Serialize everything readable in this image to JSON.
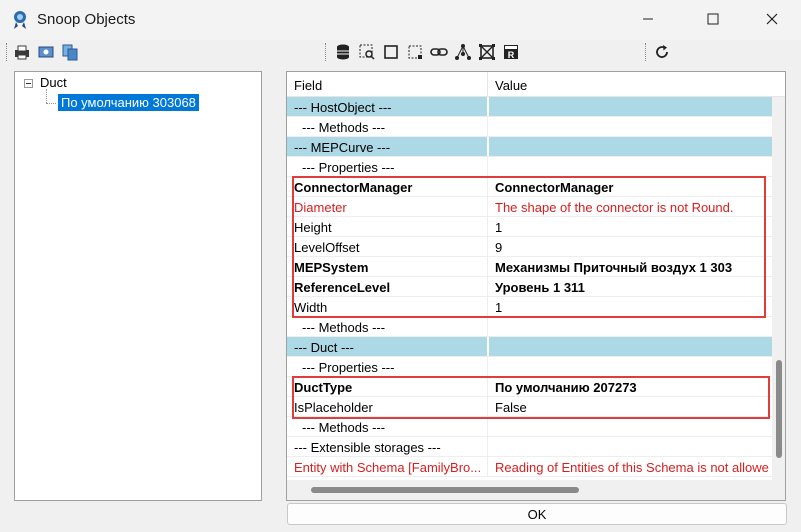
{
  "window": {
    "title": "Snoop Objects",
    "icon": "revit-lookup-icon"
  },
  "toolbar": {
    "left_icons": [
      "print-icon",
      "print-preview-icon",
      "copy-icon"
    ],
    "middle_icons": [
      "snoop-db-icon",
      "snoop-selection-icon",
      "snoop-element-icon",
      "snoop-pick-face-icon",
      "snoop-link-icon",
      "snoop-dependents-icon",
      "snoop-view-icon",
      "snoop-revit-app-icon"
    ],
    "right_icons": [
      "refresh-icon"
    ]
  },
  "tree": {
    "root": "Duct",
    "child": "По умолчанию  303068"
  },
  "grid": {
    "headers": {
      "field": "Field",
      "value": "Value"
    },
    "rows": [
      {
        "type": "section",
        "field": "--- HostObject ---",
        "value": ""
      },
      {
        "type": "sub",
        "field": "--- Methods ---",
        "value": ""
      },
      {
        "type": "section",
        "field": "--- MEPCurve ---",
        "value": ""
      },
      {
        "type": "sub",
        "field": "--- Properties ---",
        "value": ""
      },
      {
        "type": "bold",
        "field": "ConnectorManager",
        "value": "ConnectorManager"
      },
      {
        "type": "red",
        "field": "Diameter",
        "value": "The shape of the connector is not Round."
      },
      {
        "type": "plain",
        "field": "Height",
        "value": "1"
      },
      {
        "type": "plain",
        "field": "LevelOffset",
        "value": "9"
      },
      {
        "type": "bold",
        "field": "MEPSystem",
        "value": "Механизмы Приточный воздух 1  303"
      },
      {
        "type": "bold",
        "field": "ReferenceLevel",
        "value": "Уровень 1  311"
      },
      {
        "type": "plain",
        "field": "Width",
        "value": "1"
      },
      {
        "type": "sub",
        "field": "--- Methods ---",
        "value": ""
      },
      {
        "type": "section",
        "field": "--- Duct ---",
        "value": ""
      },
      {
        "type": "sub",
        "field": "--- Properties ---",
        "value": ""
      },
      {
        "type": "bold",
        "field": "DuctType",
        "value": "По умолчанию  207273"
      },
      {
        "type": "plain",
        "field": "IsPlaceholder",
        "value": "False"
      },
      {
        "type": "sub",
        "field": "--- Methods ---",
        "value": ""
      },
      {
        "type": "plain",
        "field": "--- Extensible storages ---",
        "value": ""
      },
      {
        "type": "red",
        "field": "Entity with Schema [FamilyBro...",
        "value": "Reading of Entities of this Schema is not allowe"
      }
    ]
  },
  "highlight_color": "#e03c3c",
  "section_color": "#add8e6",
  "selection_color": "#0078d7",
  "footer": {
    "ok_label": "OK"
  }
}
